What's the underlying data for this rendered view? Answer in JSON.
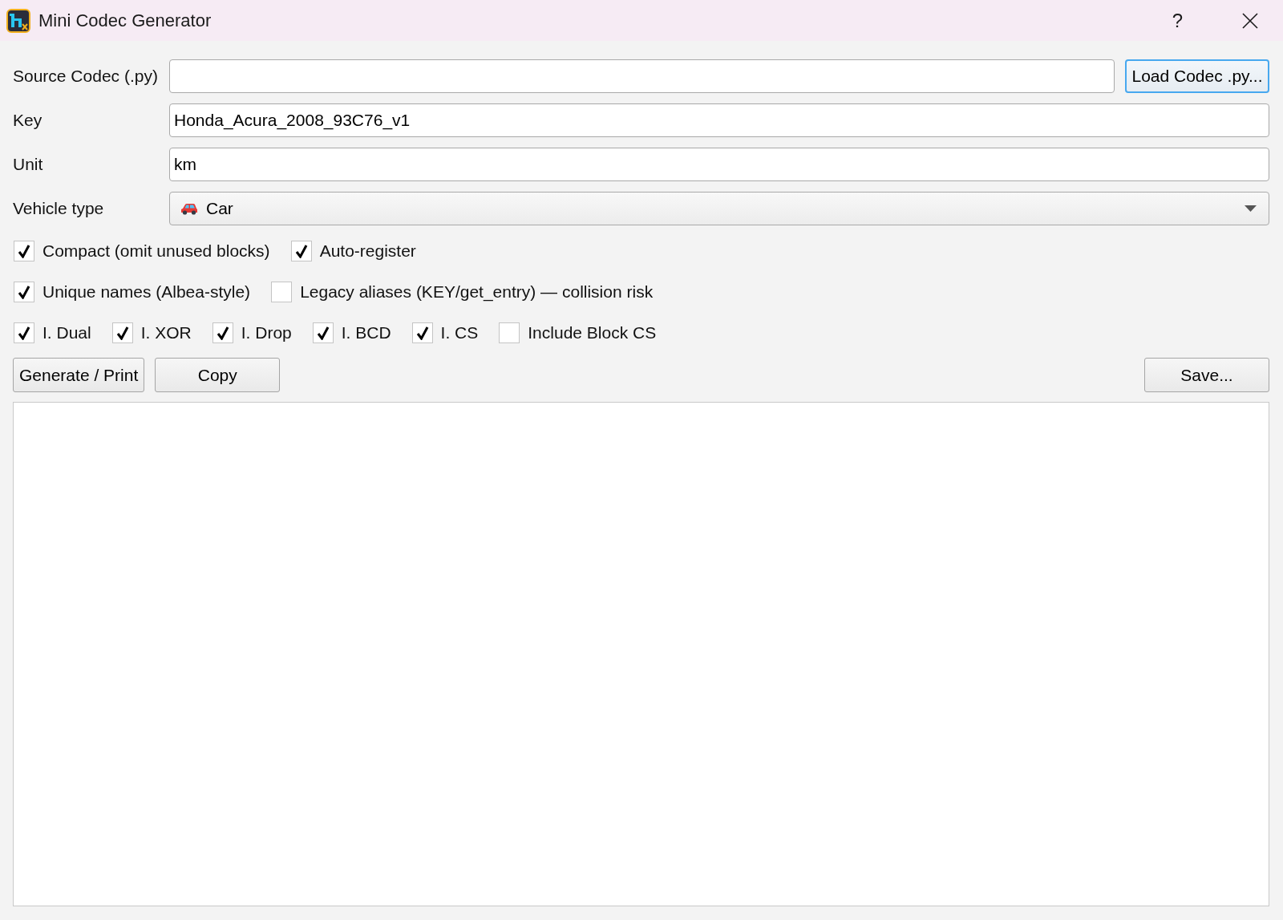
{
  "window": {
    "title": "Mini Codec Generator",
    "help": "?"
  },
  "fields": [
    {
      "kind": "file",
      "label": "Source Codec (.py)",
      "button": {
        "label": "Load Codec .py...",
        "focused": true
      }
    },
    {
      "kind": "text",
      "label": "Key",
      "value": "Honda_Acura_2008_93C76_v1"
    },
    {
      "kind": "text",
      "label": "Unit",
      "value": "km"
    },
    {
      "kind": "select",
      "label": "Vehicle type",
      "value": "Car"
    }
  ],
  "option_rows": [
    {
      "items": [
        {
          "label": "Compact (omit unused blocks)",
          "checked": true
        },
        {
          "label": "Auto-register",
          "checked": true
        }
      ]
    },
    {
      "items": [
        {
          "label": "Unique names (Albea-style)",
          "checked": true
        },
        {
          "label": "Legacy aliases (KEY/get_entry) — collision risk",
          "checked": false
        }
      ]
    },
    {
      "items": [
        {
          "label": "I. Dual",
          "checked": true
        },
        {
          "label": "I. XOR",
          "checked": true
        },
        {
          "label": "I. Drop",
          "checked": true
        },
        {
          "label": "I. BCD",
          "checked": true
        },
        {
          "label": "I. CS",
          "checked": true
        },
        {
          "label": "Include Block CS",
          "checked": false
        }
      ]
    }
  ],
  "actions": {
    "left": [
      "Generate / Print",
      "Copy"
    ],
    "right": [
      "Save..."
    ]
  }
}
